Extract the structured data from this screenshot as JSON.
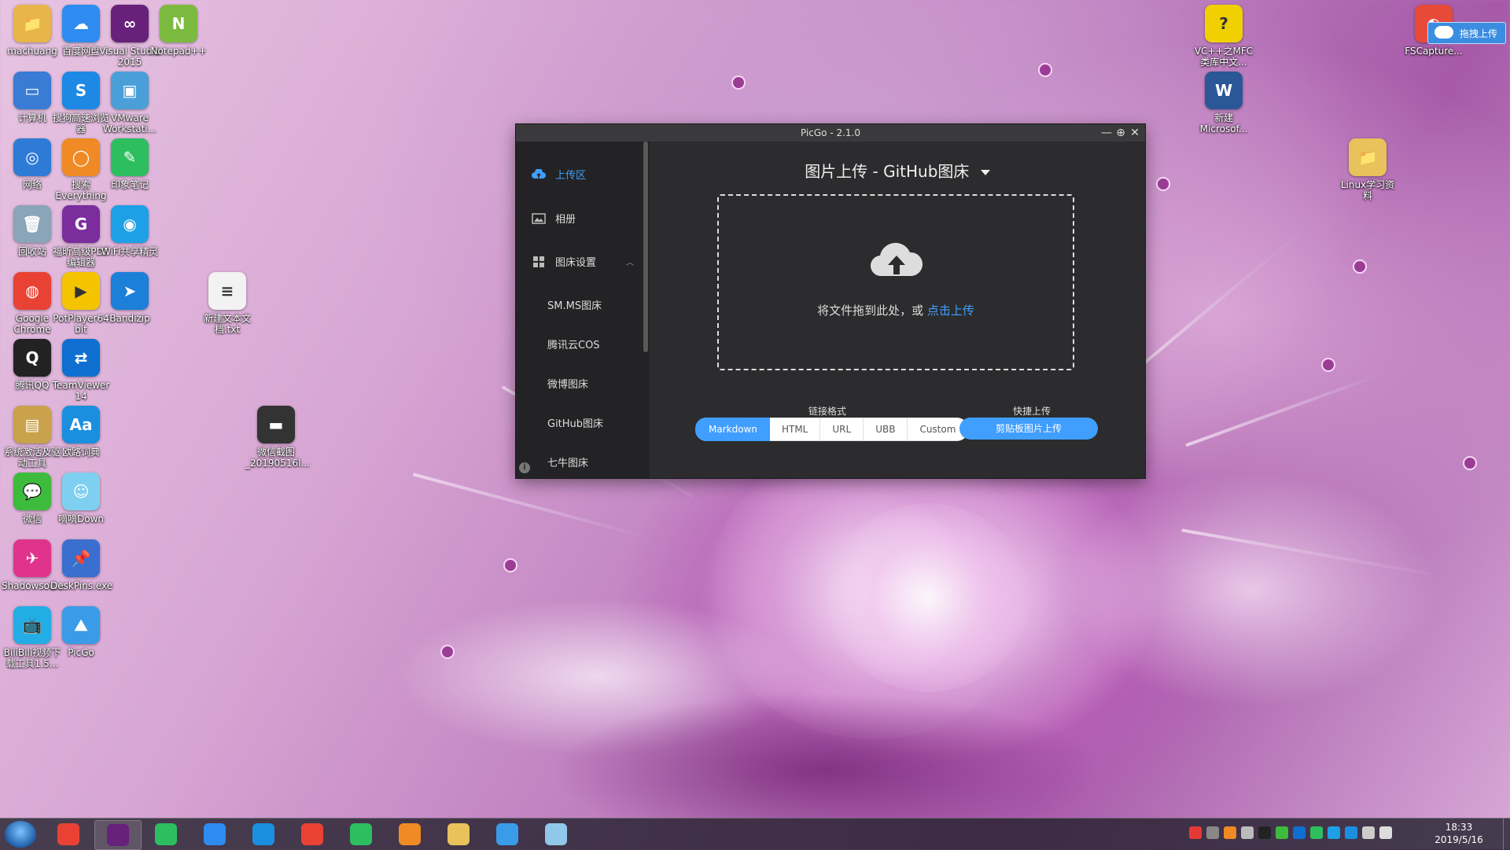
{
  "desktop": {
    "icons": [
      {
        "label": "machuang",
        "icon": "folder-icon",
        "color": "#e8b54a",
        "glyph": "📁"
      },
      {
        "label": "百度网盘",
        "icon": "baidu-netdisk-icon",
        "color": "#2e8cf0",
        "glyph": "☁"
      },
      {
        "label": "Visual Studio 2015",
        "icon": "visual-studio-icon",
        "color": "#68217a",
        "glyph": "∞"
      },
      {
        "label": "Notepad++",
        "icon": "notepad-plus-plus-icon",
        "color": "#7cba3f",
        "glyph": "N"
      },
      {
        "label": "计算机",
        "icon": "computer-icon",
        "color": "#3a7bd5",
        "glyph": "▭"
      },
      {
        "label": "搜狗高速浏览器",
        "icon": "sogou-browser-icon",
        "color": "#1e88e5",
        "glyph": "S"
      },
      {
        "label": "VMware Workstati...",
        "icon": "vmware-icon",
        "color": "#4a9fd8",
        "glyph": "▣"
      },
      {
        "label": "网络",
        "icon": "network-icon",
        "color": "#2e7bd6",
        "glyph": "◎"
      },
      {
        "label": "搜索 Everything",
        "icon": "everything-search-icon",
        "color": "#f08a24",
        "glyph": "◯"
      },
      {
        "label": "印象笔记",
        "icon": "evernote-icon",
        "color": "#2dbe60",
        "glyph": "✎"
      },
      {
        "label": "回收站",
        "icon": "recycle-bin-icon",
        "color": "#8aa4b8",
        "glyph": "🗑"
      },
      {
        "label": "福昕高级PDF编辑器",
        "icon": "foxit-pdf-icon",
        "color": "#7b2d9e",
        "glyph": "G"
      },
      {
        "label": "WiFi共享精灵",
        "icon": "wifi-share-icon",
        "color": "#1ea0e6",
        "glyph": "◉"
      },
      {
        "label": "Google Chrome",
        "icon": "chrome-icon",
        "color": "#e94235",
        "glyph": "◍"
      },
      {
        "label": "PotPlayer64 bit",
        "icon": "potplayer-icon",
        "color": "#f5c400",
        "glyph": "▶"
      },
      {
        "label": "Bandizip",
        "icon": "bandizip-icon",
        "color": "#1c7fd8",
        "glyph": "➤"
      },
      {
        "label": "新建文本文档.txt",
        "icon": "text-file-icon",
        "color": "#f2f2f2",
        "glyph": "≡"
      },
      {
        "label": "腾讯QQ",
        "icon": "qq-icon",
        "color": "#222222",
        "glyph": "Q"
      },
      {
        "label": "TeamViewer 14",
        "icon": "teamviewer-icon",
        "color": "#0e6fd1",
        "glyph": "⇄"
      },
      {
        "label": "系统激活及驱动工具",
        "icon": "activation-tool-icon",
        "color": "#c9a24b",
        "glyph": "▤"
      },
      {
        "label": "欧路词典",
        "icon": "eudic-icon",
        "color": "#1a8fe0",
        "glyph": "Aa"
      },
      {
        "label": "微信截图_20190516l...",
        "icon": "screenshot-file-icon",
        "color": "#333333",
        "glyph": "▬"
      },
      {
        "label": "微信",
        "icon": "wechat-icon",
        "color": "#3dbb3d",
        "glyph": "💬"
      },
      {
        "label": "嘀嘀Down",
        "icon": "didi-down-icon",
        "color": "#7fd0f0",
        "glyph": "☺"
      },
      {
        "label": "Shadowsoc...",
        "icon": "shadowsocks-icon",
        "color": "#e0348c",
        "glyph": "✈"
      },
      {
        "label": "DeskPins.exe",
        "icon": "deskpins-icon",
        "color": "#3a6fd0",
        "glyph": "📌"
      },
      {
        "label": "BiliBili视频下载工具1.5...",
        "icon": "bilibili-icon",
        "color": "#23ade5",
        "glyph": "📺"
      },
      {
        "label": "PicGo",
        "icon": "picgo-icon",
        "color": "#3a9be8",
        "glyph": "⛰"
      },
      {
        "label": "VC++之MFC类库中文...",
        "icon": "help-file-icon",
        "color": "#f0d000",
        "glyph": "?"
      },
      {
        "label": "新建 Microsof...",
        "icon": "word-doc-icon",
        "color": "#2b5797",
        "glyph": "W"
      },
      {
        "label": "Linux学习资料",
        "icon": "folder-icon",
        "color": "#e8c25a",
        "glyph": "📁"
      },
      {
        "label": "FSCapture...",
        "icon": "fscapture-icon",
        "color": "#e84a3a",
        "glyph": "◐"
      }
    ]
  },
  "fscapture_widget": {
    "label": "拖拽上传"
  },
  "picgo": {
    "title": "PicGo - 2.1.0",
    "window_controls": {
      "minimize": "—",
      "maximize": "⊕",
      "close": "✕"
    },
    "nav": {
      "upload": "上传区",
      "gallery": "相册",
      "picbed_settings": "图床设置",
      "subitems": [
        "SM.MS图床",
        "腾讯云COS",
        "微博图床",
        "GitHub图床",
        "七牛图床"
      ]
    },
    "info_glyph": "i",
    "main_title": "图片上传 - GitHub图床",
    "dropzone": {
      "text": "将文件拖到此处，或 ",
      "link": "点击上传"
    },
    "link_format": {
      "label": "链接格式",
      "options": [
        "Markdown",
        "HTML",
        "URL",
        "UBB",
        "Custom"
      ],
      "selected": "Markdown"
    },
    "quick_upload": {
      "label": "快捷上传",
      "button": "剪贴板图片上传"
    }
  },
  "taskbar": {
    "apps": [
      {
        "icon": "chrome-icon",
        "color": "#e94235"
      },
      {
        "icon": "visual-studio-icon",
        "color": "#68217a"
      },
      {
        "icon": "evernote-icon",
        "color": "#2dbe60"
      },
      {
        "icon": "baidu-netdisk-icon",
        "color": "#2e8cf0"
      },
      {
        "icon": "eudic-icon",
        "color": "#1a8fe0"
      },
      {
        "icon": "chrome-icon",
        "color": "#e94235"
      },
      {
        "icon": "evernote-icon",
        "color": "#2dbe60"
      },
      {
        "icon": "everything-search-icon",
        "color": "#f08a24"
      },
      {
        "icon": "file-explorer-icon",
        "color": "#e8c25a"
      },
      {
        "icon": "picgo-icon",
        "color": "#3a9be8"
      },
      {
        "icon": "notes-icon",
        "color": "#8fc8e8"
      }
    ],
    "time": "18:33",
    "date": "2019/5/16"
  }
}
